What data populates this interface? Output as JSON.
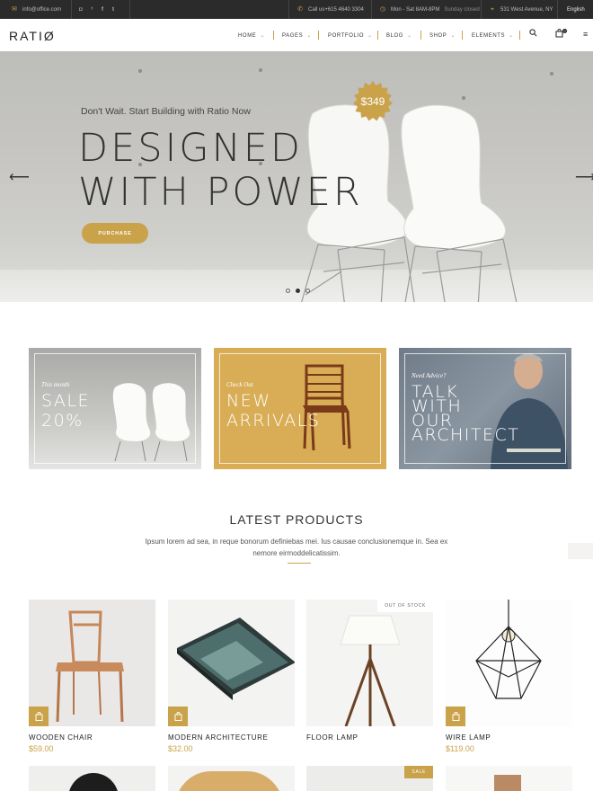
{
  "topbar": {
    "email": "info@office.com",
    "social": [
      "ig",
      "tw",
      "f",
      "t"
    ],
    "phone": "Call us+615 4640 3304",
    "hours": "Mon - Sat 8AM-8PM",
    "hours_note": "Sunday closed",
    "address": "531 West Avenue, NY",
    "language": "English"
  },
  "header": {
    "logo": "RATIØ",
    "nav": [
      "HOME",
      "PAGES",
      "PORTFOLIO",
      "BLOG",
      "SHOP",
      "ELEMENTS"
    ],
    "cart_count": "0"
  },
  "hero": {
    "subtitle": "Don't Wait. Start Building with Ratio Now",
    "title_line1": "DESIGNED",
    "title_line2": "WITH POWER",
    "button": "PURCHASE",
    "price": "$349",
    "slides": 3,
    "active_slide": 2
  },
  "promos": [
    {
      "small": "This month",
      "line1": "SALE",
      "line2": "20%",
      "line3": "",
      "line4": ""
    },
    {
      "small": "Check Out",
      "line1": "NEW",
      "line2": "ARRIVALS",
      "line3": "",
      "line4": ""
    },
    {
      "small": "Need Advice?",
      "line1": "TALK",
      "line2": "WITH",
      "line3": "OUR",
      "line4": "ARCHITECT"
    }
  ],
  "latest": {
    "title": "LATEST PRODUCTS",
    "description": "Ipsum lorem ad sea, in reque bonorum definiebas mei. Ius causae conclusionemque in. Sea ex nemore eirmoddelicatissim."
  },
  "products": [
    {
      "name": "WOODEN CHAIR",
      "price": "$59.00",
      "badge": ""
    },
    {
      "name": "MODERN ARCHITECTURE",
      "price": "$32.00",
      "badge": ""
    },
    {
      "name": "FLOOR LAMP",
      "price": "",
      "badge": "OUT OF STOCK"
    },
    {
      "name": "WIRE LAMP",
      "price": "$119.00",
      "badge": ""
    }
  ],
  "products_row2_badges": [
    "",
    "",
    "SALE",
    ""
  ],
  "colors": {
    "accent": "#c9a24a",
    "topbar": "#2b2b2b",
    "text": "#333333"
  }
}
